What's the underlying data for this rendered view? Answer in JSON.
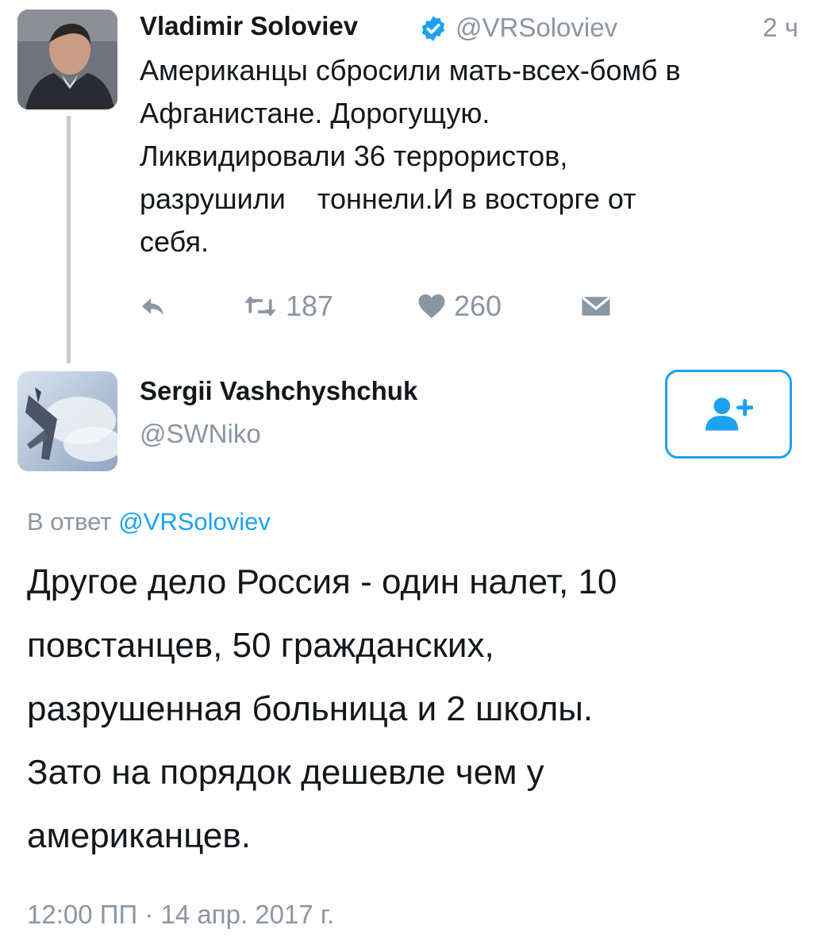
{
  "parent_tweet": {
    "author_name": "Vladimir Soloviev",
    "handle": "@VRSoloviev",
    "time_ago": "2 ч",
    "text_lines": [
      "Американцы сбросили мать-всех-бомб в",
      "Афганистане. Дорогущую.",
      "Ликвидировали 36 террористов,",
      "разрушили    тоннели.И в восторге от",
      "себя."
    ],
    "retweet_count": "187",
    "like_count": "260",
    "icons": {
      "verified": "verified-badge-icon",
      "reply": "reply-icon",
      "retweet": "retweet-icon",
      "like": "heart-icon",
      "direct_message": "envelope-icon"
    }
  },
  "reply_tweet": {
    "author_name": "Sergii Vashchyshchuk",
    "handle": "@SWNiko",
    "follow_icon": "add-user-icon",
    "reply_to_label": "В ответ",
    "reply_to_handle": "@VRSoloviev",
    "text_lines": [
      "Другое дело Россия - один налет, 10",
      "повстанцев, 50 гражданских,",
      "разрушенная больница и 2 школы.",
      "Зато на порядок дешевле чем у",
      "американцев."
    ],
    "timestamp": "12:00 ПП · 14 апр. 2017 г."
  },
  "colors": {
    "accent": "#1da1f2",
    "secondary_text": "#8a96a3",
    "primary_text": "#14171a",
    "thread_line": "#c7ccd1"
  }
}
